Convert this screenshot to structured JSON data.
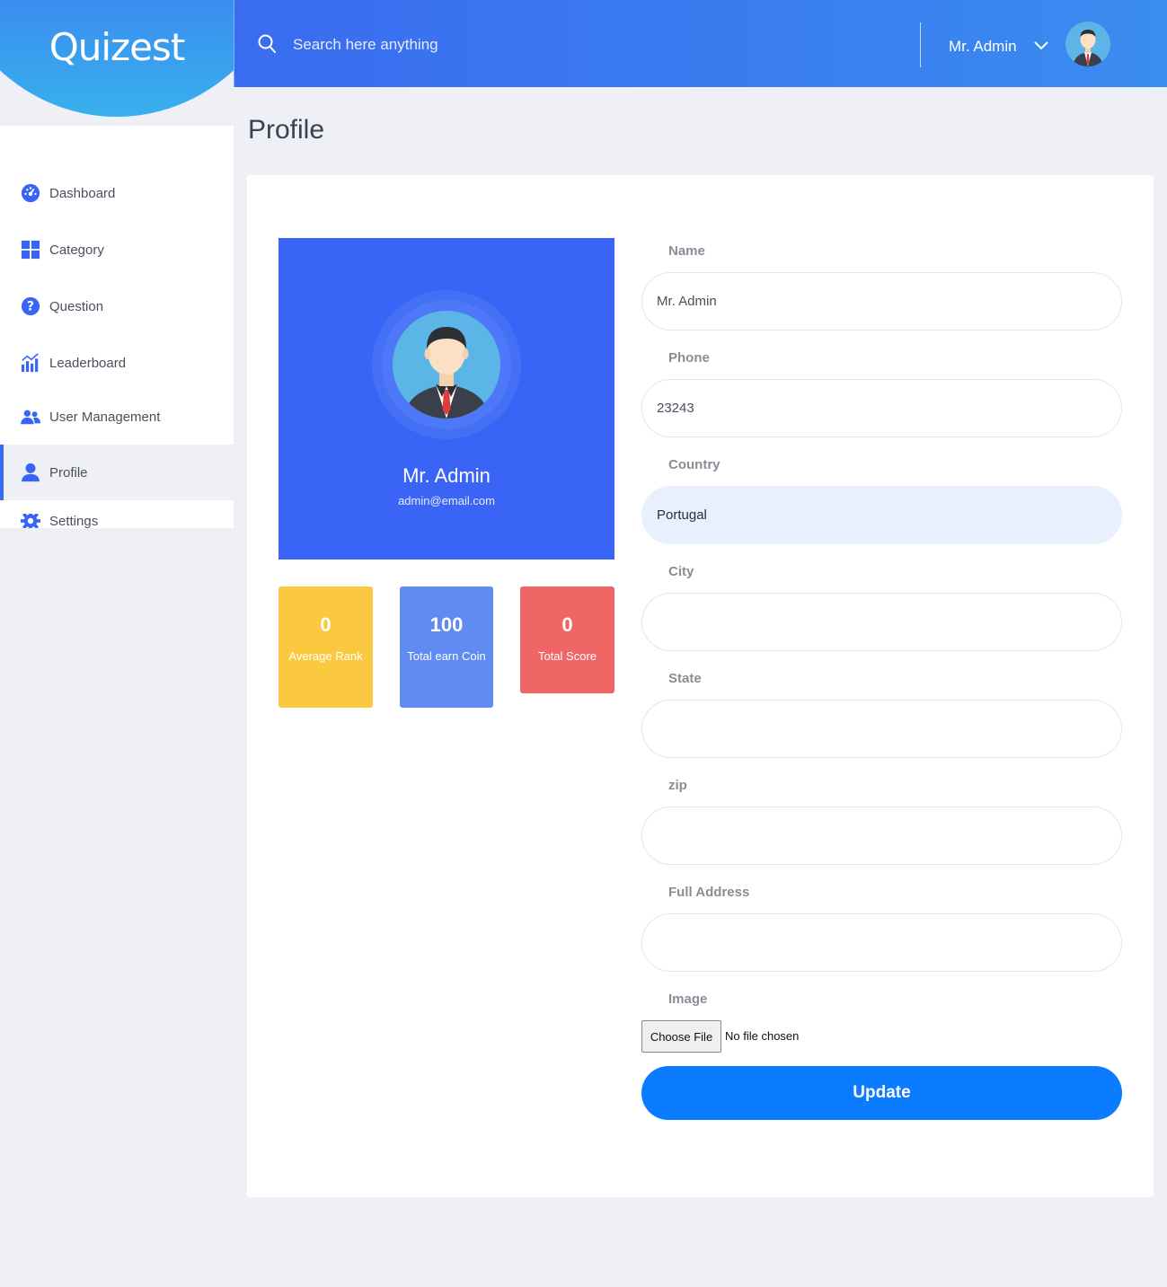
{
  "app": {
    "logo": "Quizest"
  },
  "header": {
    "search_placeholder": "Search here anything",
    "user_name": "Mr. Admin"
  },
  "sidebar": {
    "items": [
      {
        "label": "Dashboard",
        "icon": "dashboard-gauge-icon"
      },
      {
        "label": "Category",
        "icon": "grid-icon"
      },
      {
        "label": "Question",
        "icon": "question-circle-icon"
      },
      {
        "label": "Leaderboard",
        "icon": "chart-bars-icon"
      },
      {
        "label": "User Management",
        "icon": "users-icon"
      },
      {
        "label": "Profile",
        "icon": "user-icon",
        "active": true
      },
      {
        "label": "Settings",
        "icon": "gear-icon"
      }
    ]
  },
  "page": {
    "title": "Profile"
  },
  "profile": {
    "name": "Mr. Admin",
    "email": "admin@email.com",
    "box_color": "#3a64f5"
  },
  "stats": [
    {
      "value": "0",
      "label": "Average Rank",
      "color": "#fbc940"
    },
    {
      "value": "100",
      "label": "Total earn Coin",
      "color": "#5f8bf2"
    },
    {
      "value": "0",
      "label": "Total Score",
      "color": "#f06566"
    }
  ],
  "form": {
    "name": {
      "label": "Name",
      "value": "Mr. Admin"
    },
    "phone": {
      "label": "Phone",
      "value": "23243"
    },
    "country": {
      "label": "Country",
      "value": "Portugal"
    },
    "city": {
      "label": "City",
      "value": ""
    },
    "state": {
      "label": "State",
      "value": ""
    },
    "zip": {
      "label": "zip",
      "value": ""
    },
    "address": {
      "label": "Full Address",
      "value": ""
    },
    "image": {
      "label": "Image",
      "button": "Choose File",
      "status": "No file chosen"
    },
    "submit": "Update"
  },
  "colors": {
    "accent": "#3a6cf0",
    "update_button": "#0b7bff"
  }
}
